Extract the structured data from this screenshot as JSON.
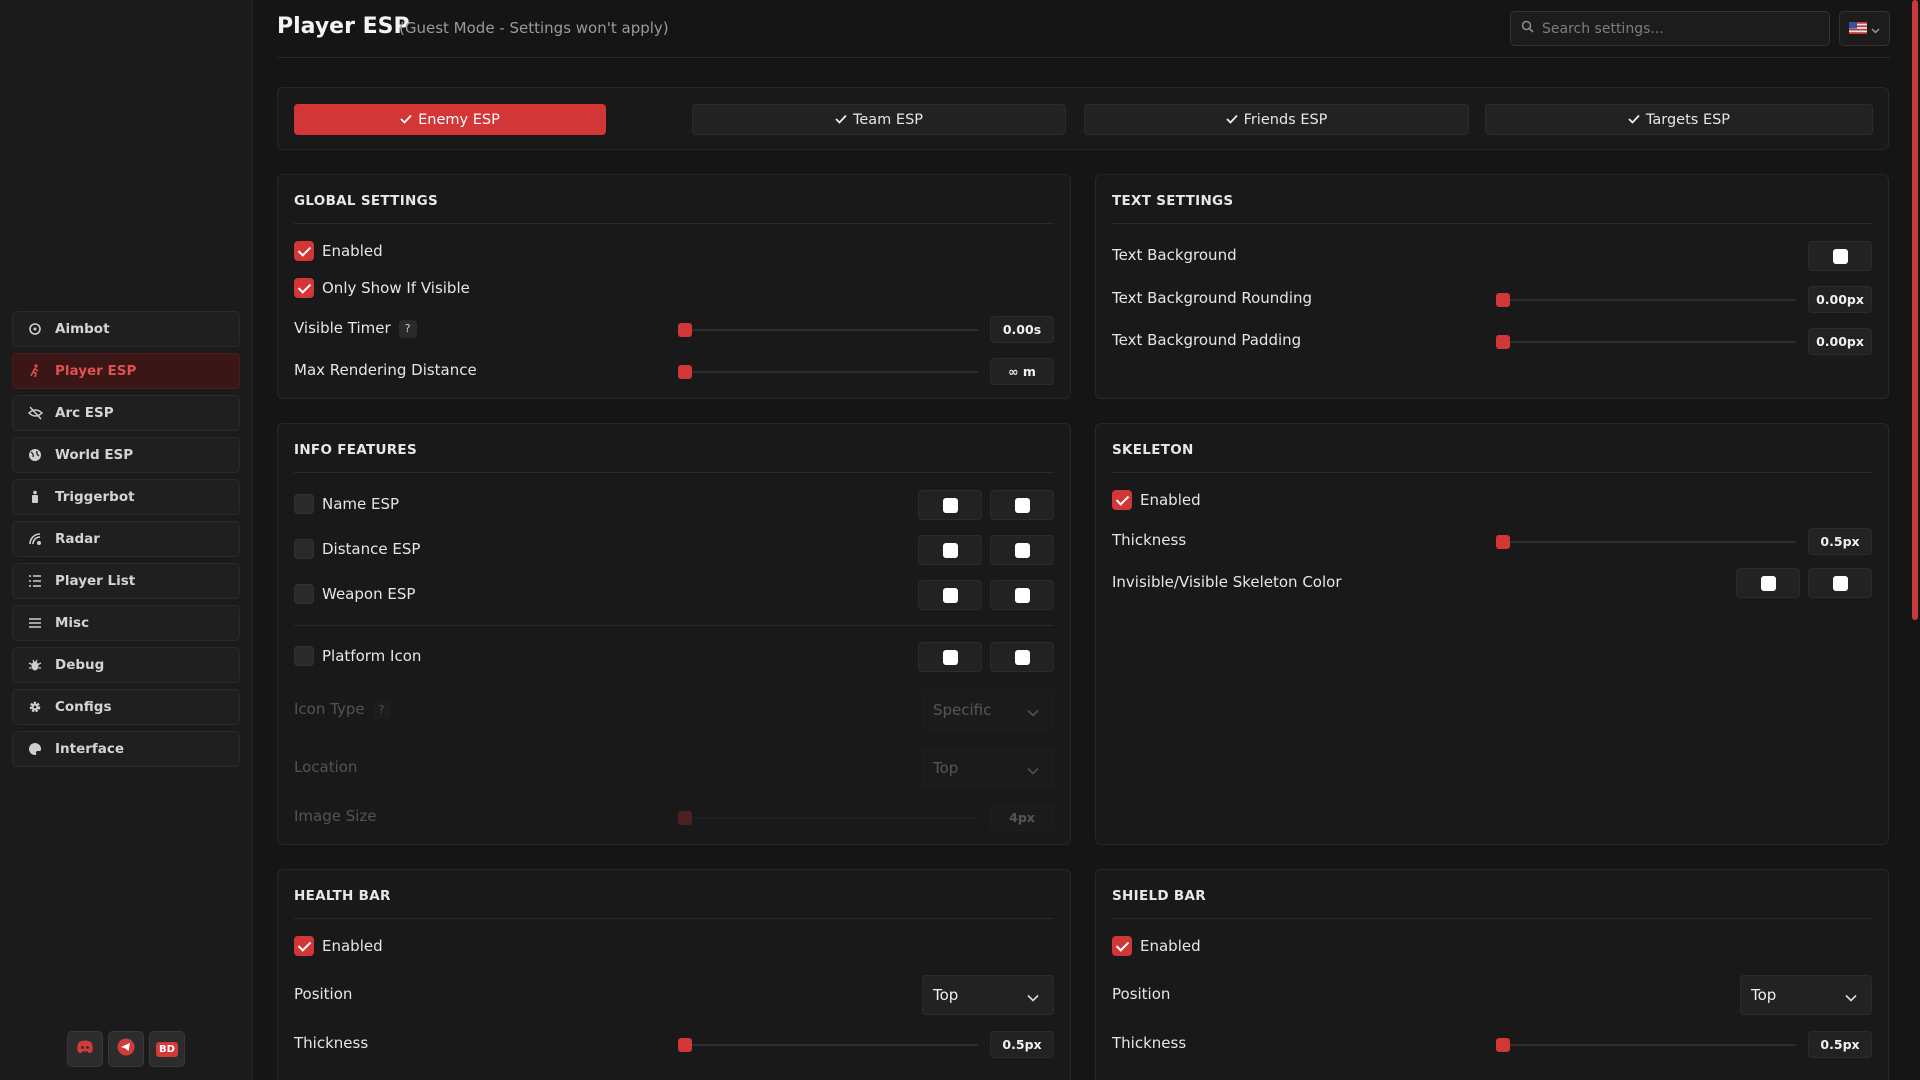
{
  "header": {
    "title": "Player ESP",
    "subtitle": "(Guest Mode - Settings won't apply)",
    "search_placeholder": "Search settings...",
    "language_icon": "us-flag-icon"
  },
  "sidebar": {
    "items": [
      {
        "label": "Aimbot",
        "icon": "crosshair-icon"
      },
      {
        "label": "Player ESP",
        "icon": "running-person-icon",
        "active": true
      },
      {
        "label": "Arc ESP",
        "icon": "eye-off-icon"
      },
      {
        "label": "World ESP",
        "icon": "globe-icon"
      },
      {
        "label": "Triggerbot",
        "icon": "trigger-icon"
      },
      {
        "label": "Radar",
        "icon": "radar-icon"
      },
      {
        "label": "Player List",
        "icon": "list-icon"
      },
      {
        "label": "Misc",
        "icon": "menu-icon"
      },
      {
        "label": "Debug",
        "icon": "bug-icon"
      },
      {
        "label": "Configs",
        "icon": "gear-icon"
      },
      {
        "label": "Interface",
        "icon": "palette-icon"
      }
    ],
    "social": [
      {
        "icon": "discord-icon"
      },
      {
        "icon": "telegram-icon"
      },
      {
        "label": "BD",
        "icon": "bd-icon"
      }
    ]
  },
  "tabs": [
    {
      "label": "Enemy ESP",
      "active": true
    },
    {
      "label": "Team ESP"
    },
    {
      "label": "Friends ESP"
    },
    {
      "label": "Targets ESP"
    }
  ],
  "global_settings": {
    "title": "GLOBAL SETTINGS",
    "enabled": {
      "label": "Enabled",
      "checked": true
    },
    "only_visible": {
      "label": "Only Show If Visible",
      "checked": true
    },
    "visible_timer": {
      "label": "Visible Timer",
      "help": "?",
      "value": "0.00s",
      "fraction": 0
    },
    "max_distance": {
      "label": "Max Rendering Distance",
      "value": "∞ m",
      "fraction": 0
    }
  },
  "text_settings": {
    "title": "TEXT SETTINGS",
    "background": {
      "label": "Text Background"
    },
    "rounding": {
      "label": "Text Background Rounding",
      "value": "0.00px",
      "fraction": 0
    },
    "padding": {
      "label": "Text Background Padding",
      "value": "0.00px",
      "fraction": 0
    }
  },
  "info_features": {
    "title": "INFO FEATURES",
    "name_esp": {
      "label": "Name ESP",
      "checked": false
    },
    "distance_esp": {
      "label": "Distance ESP",
      "checked": false
    },
    "weapon_esp": {
      "label": "Weapon ESP",
      "checked": false
    },
    "platform_icon": {
      "label": "Platform Icon",
      "checked": false
    },
    "icon_type": {
      "label": "Icon Type",
      "help": "?",
      "value": "Specific"
    },
    "location": {
      "label": "Location",
      "value": "Top"
    },
    "image_size": {
      "label": "Image Size",
      "value": "4px",
      "fraction": 0
    }
  },
  "skeleton": {
    "title": "SKELETON",
    "enabled": {
      "label": "Enabled",
      "checked": true
    },
    "thickness": {
      "label": "Thickness",
      "value": "0.5px",
      "fraction": 0
    },
    "color": {
      "label": "Invisible/Visible Skeleton Color"
    }
  },
  "health_bar": {
    "title": "HEALTH BAR",
    "enabled": {
      "label": "Enabled",
      "checked": true
    },
    "position": {
      "label": "Position",
      "value": "Top"
    },
    "thickness": {
      "label": "Thickness",
      "value": "0.5px",
      "fraction": 0
    }
  },
  "shield_bar": {
    "title": "SHIELD BAR",
    "enabled": {
      "label": "Enabled",
      "checked": true
    },
    "position": {
      "label": "Position",
      "value": "Top"
    },
    "thickness": {
      "label": "Thickness",
      "value": "0.5px",
      "fraction": 0
    }
  },
  "colors": {
    "accent": "#d23636",
    "background": "#151515",
    "panel": "#191919"
  }
}
